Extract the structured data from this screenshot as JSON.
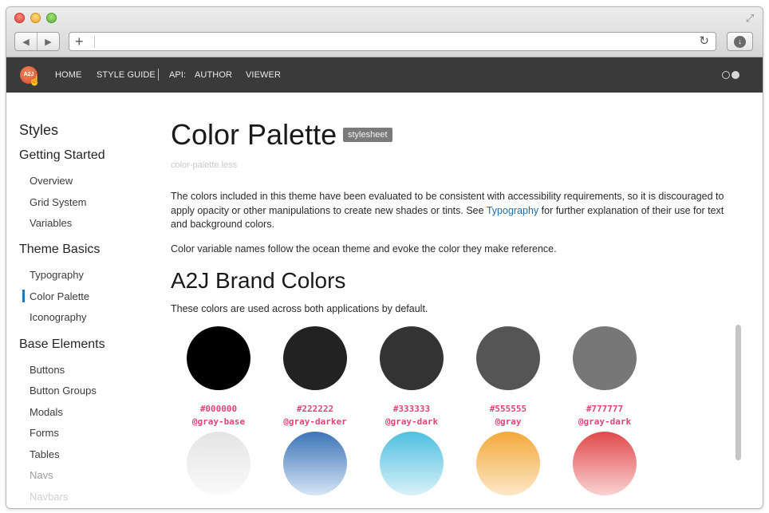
{
  "browser": {
    "back_icon": "◀",
    "forward_icon": "▶",
    "new_tab_icon": "+",
    "reload_icon": "↻",
    "download_icon": "↓",
    "fullscreen_icon": "⤢"
  },
  "topnav": {
    "logo_text": "A2J",
    "links": [
      "HOME",
      "STYLE GUIDE",
      "API:",
      "AUTHOR",
      "VIEWER"
    ]
  },
  "sidebar": {
    "title": "Styles",
    "sections": [
      {
        "title": "Getting Started",
        "items": [
          "Overview",
          "Grid System",
          "Variables"
        ]
      },
      {
        "title": "Theme Basics",
        "items": [
          "Typography",
          "Color Palette",
          "Iconography"
        ]
      },
      {
        "title": "Base Elements",
        "items": [
          "Buttons",
          "Button Groups",
          "Modals",
          "Forms",
          "Tables",
          "Navs",
          "Navbars"
        ]
      }
    ],
    "active_item": "Color Palette"
  },
  "content": {
    "title": "Color Palette",
    "badge": "stylesheet",
    "filename": "color-palette.less",
    "para1_before": "The colors included in this theme have been evaluated to be consistent with accessibility requirements, so it is discouraged to apply opacity or other manipulations to create new shades or tints. See ",
    "para1_link": "Typography",
    "para1_after": " for further explanation of their use for text and background colors.",
    "para2": "Color variable names follow the ocean theme and evoke the color they make reference.",
    "section_title": "A2J Brand Colors",
    "section_desc": "These colors are used across both applications by default.",
    "swatches": [
      {
        "code": "#000000",
        "var": "@gray-base",
        "color": "#000000"
      },
      {
        "code": "#222222",
        "var": "@gray-darker",
        "color": "#222222"
      },
      {
        "code": "#333333",
        "var": "@gray-dark",
        "color": "#333333"
      },
      {
        "code": "#555555",
        "var": "@gray",
        "color": "#555555"
      },
      {
        "code": "#777777",
        "var": "@gray-dark",
        "color": "#777777"
      }
    ],
    "gradient_swatches": [
      {
        "top": "#e4e4e4",
        "bottom": "#fafafa"
      },
      {
        "top": "#3b74b8",
        "bottom": "#d7e5f5"
      },
      {
        "top": "#4fbfe0",
        "bottom": "#d9f2f8"
      },
      {
        "top": "#f2a93b",
        "bottom": "#fde7c7"
      },
      {
        "top": "#e0494a",
        "bottom": "#fbd2d2"
      }
    ]
  }
}
